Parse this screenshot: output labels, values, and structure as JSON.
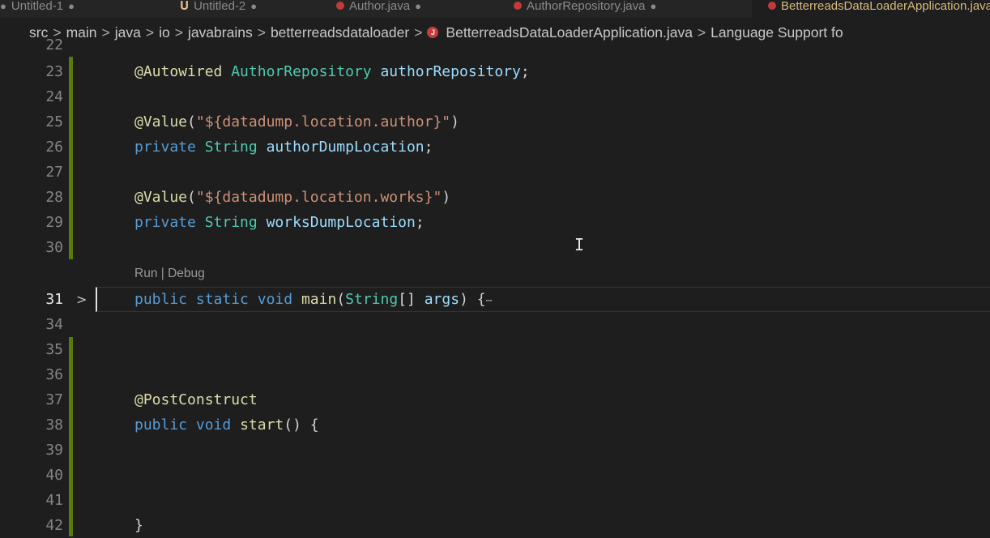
{
  "tabs": [
    {
      "label": "Untitled-1",
      "modified": true
    },
    {
      "label": "Untitled-2",
      "modified": true
    },
    {
      "label": "Author.java",
      "modified": true
    },
    {
      "label": "AuthorRepository.java",
      "modified": true
    },
    {
      "label": "BetterreadsDataLoaderApplication.java",
      "modified": false
    }
  ],
  "breadcrumb": {
    "items": [
      "src",
      "main",
      "java",
      "io",
      "javabrains",
      "betterreadsdataloader"
    ],
    "file": "BetterreadsDataLoaderApplication.java",
    "last": "Language Support fo"
  },
  "codelens": "Run | Debug",
  "code_lines": [
    {
      "num": "23",
      "tokens": [
        [
          "@Autowired",
          "ann"
        ],
        [
          " ",
          "punct"
        ],
        [
          "AuthorRepository",
          "type"
        ],
        [
          " ",
          "punct"
        ],
        [
          "authorRepository",
          "ident"
        ],
        [
          ";",
          "punct"
        ]
      ]
    },
    {
      "num": "24",
      "tokens": []
    },
    {
      "num": "25",
      "tokens": [
        [
          "@Value",
          "ann"
        ],
        [
          "(",
          "punct"
        ],
        [
          "\"${datadump.location.author}\"",
          "str"
        ],
        [
          ")",
          "punct"
        ]
      ]
    },
    {
      "num": "26",
      "tokens": [
        [
          "private",
          "kw"
        ],
        [
          " ",
          "punct"
        ],
        [
          "String",
          "type"
        ],
        [
          " ",
          "punct"
        ],
        [
          "authorDumpLocation",
          "ident"
        ],
        [
          ";",
          "punct"
        ]
      ]
    },
    {
      "num": "27",
      "tokens": []
    },
    {
      "num": "28",
      "tokens": [
        [
          "@Value",
          "ann"
        ],
        [
          "(",
          "punct"
        ],
        [
          "\"${datadump.location.works}\"",
          "str"
        ],
        [
          ")",
          "punct"
        ]
      ]
    },
    {
      "num": "29",
      "tokens": [
        [
          "private",
          "kw"
        ],
        [
          " ",
          "punct"
        ],
        [
          "String",
          "type"
        ],
        [
          " ",
          "punct"
        ],
        [
          "worksDumpLocation",
          "ident"
        ],
        [
          ";",
          "punct"
        ]
      ]
    },
    {
      "num": "30",
      "tokens": []
    },
    {
      "num": "31",
      "tokens": [
        [
          "public",
          "kw"
        ],
        [
          " ",
          "punct"
        ],
        [
          "static",
          "kw"
        ],
        [
          " ",
          "punct"
        ],
        [
          "void",
          "kw"
        ],
        [
          " ",
          "punct"
        ],
        [
          "main",
          "fn"
        ],
        [
          "(",
          "punct"
        ],
        [
          "String",
          "type"
        ],
        [
          "[] ",
          "punct"
        ],
        [
          "args",
          "ident"
        ],
        [
          ") {",
          "punct"
        ],
        [
          "⋯",
          "ellipsis"
        ]
      ]
    },
    {
      "num": "34",
      "tokens": []
    },
    {
      "num": "35",
      "tokens": []
    },
    {
      "num": "36",
      "tokens": []
    },
    {
      "num": "37",
      "tokens": [
        [
          "@PostConstruct",
          "ann"
        ]
      ]
    },
    {
      "num": "38",
      "tokens": [
        [
          "public",
          "kw"
        ],
        [
          " ",
          "punct"
        ],
        [
          "void",
          "kw"
        ],
        [
          " ",
          "punct"
        ],
        [
          "start",
          "fn"
        ],
        [
          "() {",
          "punct"
        ]
      ]
    },
    {
      "num": "39",
      "tokens": []
    },
    {
      "num": "40",
      "tokens": []
    },
    {
      "num": "41",
      "tokens": []
    },
    {
      "num": "42",
      "tokens": [
        [
          "}",
          "punct"
        ]
      ]
    }
  ],
  "partial_top_line_num": "22",
  "active_line": "31",
  "colors": {
    "diff_added": "#587c0c",
    "modified_dot": "#c23b3b",
    "active_tab_text": "#d7ba7d"
  }
}
